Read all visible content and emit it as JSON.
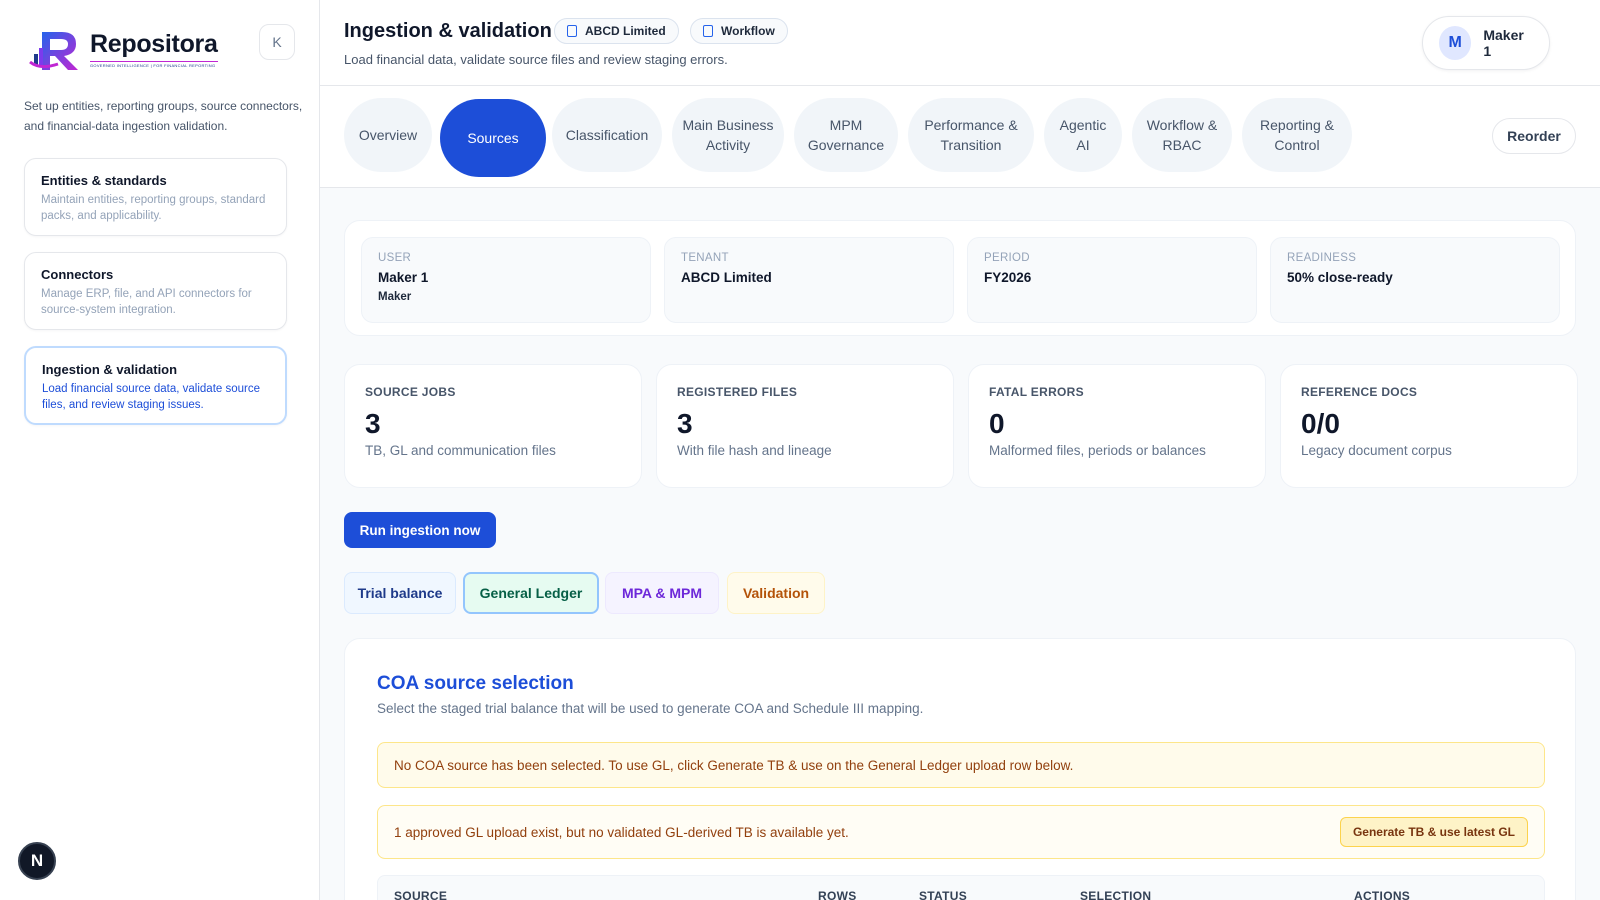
{
  "sidebar": {
    "logo_name": "Repositora",
    "logo_tagline": "GOVERNED INTELLIGENCE | FOR FINANCIAL REPORTING",
    "collapse_label": "K",
    "intro": "Set up entities, reporting groups, source connectors, and financial-data ingestion validation.",
    "items": [
      {
        "title": "Entities & standards",
        "desc": "Maintain entities, reporting groups, standard packs, and applicability."
      },
      {
        "title": "Connectors",
        "desc": "Manage ERP, file, and API connectors for source-system integration."
      },
      {
        "title": "Ingestion & validation",
        "desc": "Load financial source data, validate source files, and review staging issues."
      }
    ],
    "badge": "N"
  },
  "header": {
    "title": "Ingestion & validation",
    "chips": [
      "ABCD Limited",
      "Workflow"
    ],
    "subtitle": "Load financial data, validate source files and review staging errors.",
    "user_initial": "M",
    "user_name": "Maker 1"
  },
  "tabs": [
    {
      "label": "Overview"
    },
    {
      "label": "Sources"
    },
    {
      "label": "Classification"
    },
    {
      "label": "Main Business Activity"
    },
    {
      "label": "MPM Governance"
    },
    {
      "label": "Performance & Transition"
    },
    {
      "label": "Agentic AI"
    },
    {
      "label": "Workflow & RBAC"
    },
    {
      "label": "Reporting & Control"
    }
  ],
  "reorder_label": "Reorder",
  "context": [
    {
      "label": "USER",
      "value": "Maker 1",
      "sub": "Maker"
    },
    {
      "label": "TENANT",
      "value": "ABCD Limited",
      "sub": ""
    },
    {
      "label": "PERIOD",
      "value": "FY2026",
      "sub": ""
    },
    {
      "label": "READINESS",
      "value": "50% close-ready",
      "sub": ""
    }
  ],
  "stats": [
    {
      "label": "SOURCE JOBS",
      "value": "3",
      "desc": "TB, GL and communication files"
    },
    {
      "label": "REGISTERED FILES",
      "value": "3",
      "desc": "With file hash and lineage"
    },
    {
      "label": "FATAL ERRORS",
      "value": "0",
      "desc": "Malformed files, periods or balances"
    },
    {
      "label": "REFERENCE DOCS",
      "value": "0/0",
      "desc": "Legacy document corpus"
    }
  ],
  "run_button": "Run ingestion now",
  "sub_tabs": [
    "Trial balance",
    "General Ledger",
    "MPA & MPM",
    "Validation"
  ],
  "coa": {
    "title": "COA source selection",
    "subtitle": "Select the staged trial balance that will be used to generate COA and Schedule III mapping.",
    "alert1": "No COA source has been selected. To use GL, click Generate TB & use on the General Ledger upload row below.",
    "alert2": "1 approved GL upload exist, but no validated GL-derived TB is available yet.",
    "alert2_button": "Generate TB & use latest GL",
    "columns": [
      "SOURCE",
      "ROWS",
      "STATUS",
      "SELECTION",
      "ACTIONS"
    ]
  }
}
